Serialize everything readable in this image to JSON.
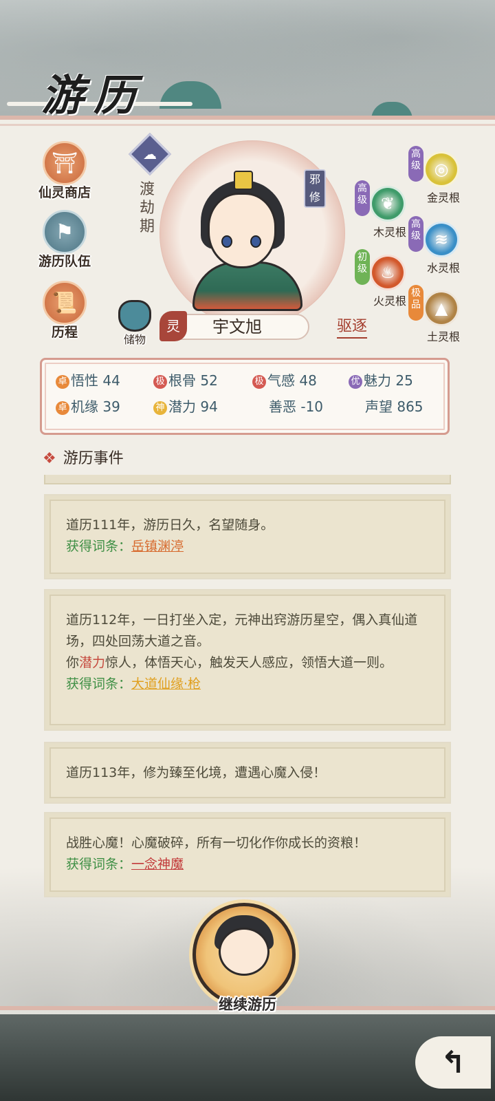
{
  "header": {
    "title": "游历"
  },
  "side_menu": [
    {
      "label": "仙灵商店",
      "icon": "shop-icon"
    },
    {
      "label": "游历队伍",
      "icon": "team-icon"
    },
    {
      "label": "历程",
      "icon": "scroll-icon"
    }
  ],
  "character": {
    "realm": "渡劫期",
    "cultivation_tag": "邪修",
    "spirit_tag": "灵",
    "name": "宇文旭",
    "expel_label": "驱逐",
    "storage_label": "储物"
  },
  "spirit_roots": [
    {
      "grade": "高级",
      "name": "金灵根",
      "color": "#d9c23a",
      "grade_color": "#8a6ab6"
    },
    {
      "grade": "高级",
      "name": "木灵根",
      "color": "#3f9b6a",
      "grade_color": "#8a6ab6"
    },
    {
      "grade": "高级",
      "name": "水灵根",
      "color": "#3a8fc7",
      "grade_color": "#8a6ab6"
    },
    {
      "grade": "初级",
      "name": "火灵根",
      "color": "#d2582c",
      "grade_color": "#6fb356"
    },
    {
      "grade": "极品",
      "name": "土灵根",
      "color": "#b08346",
      "grade_color": "#e8893a"
    }
  ],
  "stats": [
    {
      "badge": "卓",
      "badge_color": "#e8893a",
      "label": "悟性",
      "value": "44"
    },
    {
      "badge": "极",
      "badge_color": "#d45a52",
      "label": "根骨",
      "value": "52"
    },
    {
      "badge": "极",
      "badge_color": "#d45a52",
      "label": "气感",
      "value": "48"
    },
    {
      "badge": "优",
      "badge_color": "#8a6ab6",
      "label": "魅力",
      "value": "25"
    },
    {
      "badge": "卓",
      "badge_color": "#e8893a",
      "label": "机缘",
      "value": "39"
    },
    {
      "badge": "神",
      "badge_color": "#e8b43a",
      "label": "潜力",
      "value": "94"
    },
    {
      "badge": "",
      "badge_color": "",
      "label": "善恶",
      "value": "-10"
    },
    {
      "badge": "",
      "badge_color": "",
      "label": "声望",
      "value": "865"
    }
  ],
  "events_section": {
    "title": "游历事件"
  },
  "events": [
    {
      "lines": [
        "道历111年，游历日久，名望随身。"
      ],
      "gain_label": "获得词条：",
      "gain_value": "岳镇渊渟",
      "gain_color": "#d76a2e"
    },
    {
      "line1": "道历112年，一日打坐入定，元神出窍游历星空，偶入真仙道场，四处回荡大道之音。",
      "line2_a": "你",
      "line2_hl": "潜力",
      "line2_b": "惊人，体悟天心，触发天人感应，领悟大道一则。",
      "gain_label": "获得词条：",
      "gain_value": "大道仙缘·枪",
      "gain_color": "#e0a020"
    },
    {
      "lines": [
        "道历113年，修为臻至化境，遭遇心魔入侵！"
      ]
    },
    {
      "lines": [
        "战胜心魔！心魔破碎，所有一切化作你成长的资粮！"
      ],
      "gain_label": "获得词条：",
      "gain_value": "一念神魔",
      "gain_color": "#c23a3a"
    }
  ],
  "continue_button": {
    "label": "继续游历"
  },
  "back_button": {
    "icon": "back-arrow-icon"
  }
}
